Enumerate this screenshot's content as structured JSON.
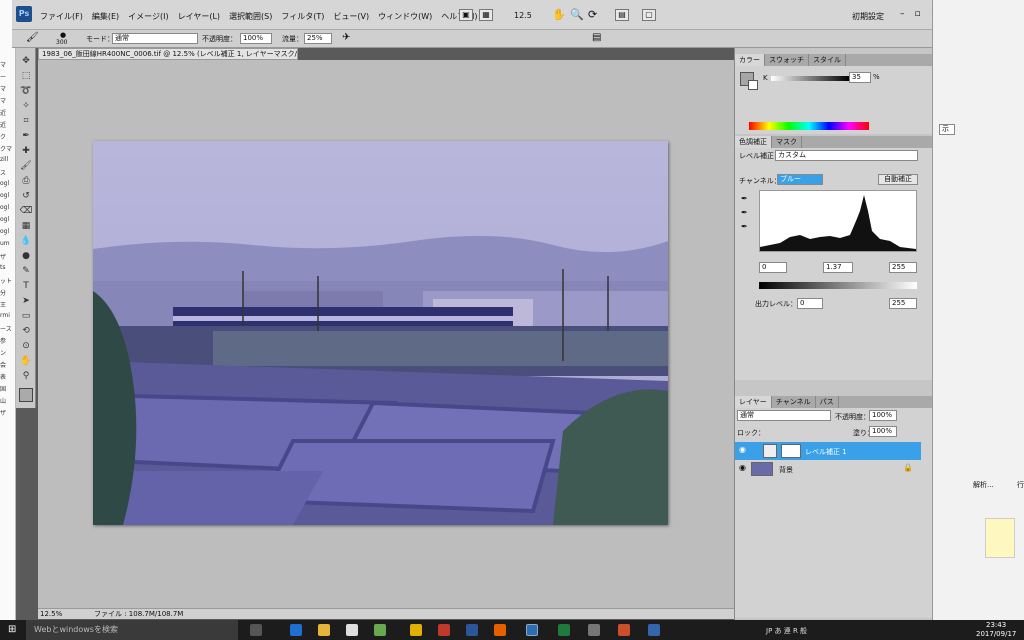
{
  "app": {
    "logo": "Ps"
  },
  "menu": [
    "ファイル(F)",
    "編集(E)",
    "イメージ(I)",
    "レイヤー(L)",
    "選択範囲(S)",
    "フィルタ(T)",
    "ビュー(V)",
    "ウィンドウ(W)",
    "ヘルプ(H)"
  ],
  "topbar": {
    "zoom": "12.5",
    "workspace": "初期設定",
    "minimize": "–",
    "restore": "▫",
    "close": "✕"
  },
  "options": {
    "brush_size": "300",
    "mode_label": "モード：",
    "mode_value": "通常",
    "opacity_label": "不透明度：",
    "opacity_value": "100%",
    "flow_label": "流量：",
    "flow_value": "25%"
  },
  "doc_tab": "1983_06_飯田線HR400NC_0006.tif @ 12.5% (レベル補正 1, レイヤーマスク/8) * ×",
  "status": {
    "zoom": "12.5%",
    "file": "ファイル : 108.7M/108.7M"
  },
  "color_panel": {
    "tabs": [
      "カラー",
      "スウォッチ",
      "スタイル"
    ],
    "channel": "K",
    "value": "35",
    "unit": "%"
  },
  "adjust_panel": {
    "tabs": [
      "色調補正",
      "マスク"
    ],
    "type": "レベル補正",
    "preset": "カスタム",
    "channel_label": "チャンネル：",
    "channel_value": "ブルー",
    "auto_button": "自動補正",
    "input_black": "0",
    "input_gamma": "1.37",
    "input_white": "255",
    "output_label": "出力レベル：",
    "output_black": "0",
    "output_white": "255"
  },
  "layers_panel": {
    "tabs": [
      "レイヤー",
      "チャンネル",
      "パス"
    ],
    "blend": "通常",
    "opacity_label": "不透明度：",
    "opacity": "100%",
    "lock_label": "ロック：",
    "fill_label": "塗り：",
    "fill": "100%",
    "layers": [
      {
        "name": "レベル補正 1",
        "selected": true
      },
      {
        "name": "背景",
        "selected": false
      }
    ]
  },
  "left_strip": [
    "マ",
    "ー",
    "マ",
    "マ",
    "近",
    "近",
    "ク",
    "クマ",
    "zill",
    "ス",
    "ogl",
    "ogl",
    "ogl",
    "ogl",
    "ogl",
    "um",
    "ザ",
    "ts",
    "ット",
    "分",
    "王",
    "rmi",
    "ース",
    "参",
    "ン",
    "会",
    "表",
    "国",
    "山",
    "ザ"
  ],
  "right_window": {
    "button": "示",
    "tab1": "解析...",
    "tab2": "行"
  },
  "taskbar": {
    "search": "Webとwindowsを検索",
    "ime": "JP あ 連 R 般",
    "time": "23:43",
    "date": "2017/09/17"
  },
  "colors": {
    "menubar": "#d6d6d6",
    "panel": "#c6c6c6",
    "canvas_bg": "#bdbdbd",
    "selected_layer": "#3aa0e8",
    "taskbar": "#1c1c1c"
  }
}
